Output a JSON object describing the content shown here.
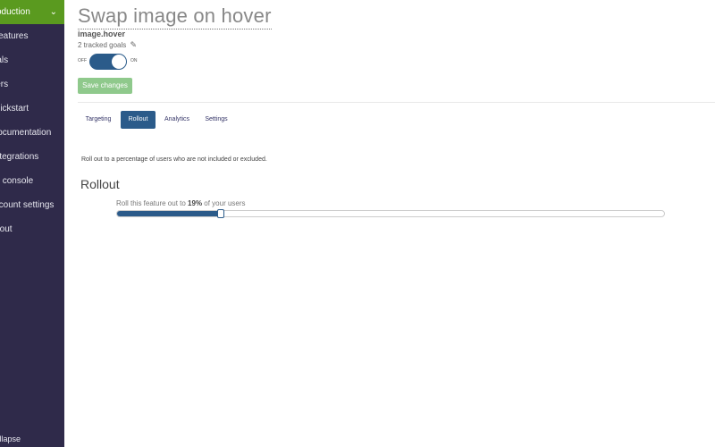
{
  "sidebar": {
    "environment": {
      "label": "Production"
    },
    "items": [
      {
        "label": "Features"
      },
      {
        "label": "Goals"
      },
      {
        "label": "Users"
      },
      {
        "label": "Quickstart"
      },
      {
        "label": "Documentation"
      },
      {
        "label": "Integrations"
      },
      {
        "label": "Debugger console"
      },
      {
        "label": "Account settings"
      },
      {
        "label": "Logout"
      }
    ],
    "collapse_label": "Collapse"
  },
  "feature": {
    "title": "Swap image on hover",
    "key": "image.hover",
    "goals": "2 tracked goals",
    "toggle": {
      "off_label": "OFF",
      "on_label": "ON",
      "state": "on"
    },
    "save_label": "Save changes"
  },
  "tabs": [
    {
      "label": "Targeting",
      "active": false
    },
    {
      "label": "Rollout",
      "active": true
    },
    {
      "label": "Analytics",
      "active": false
    },
    {
      "label": "Settings",
      "active": false
    }
  ],
  "rollout": {
    "description": "Roll out to a percentage of users who are not included or excluded.",
    "heading": "Rollout",
    "label_prefix": "Roll this feature out to ",
    "percentage_text": "19%",
    "label_suffix": " of your users",
    "percentage_value": 19
  },
  "colors": {
    "sidebar_bg": "#2f2a4a",
    "environment_bg": "#5a9a1f",
    "accent": "#2b5b8a",
    "save_button": "#8fc98c"
  }
}
